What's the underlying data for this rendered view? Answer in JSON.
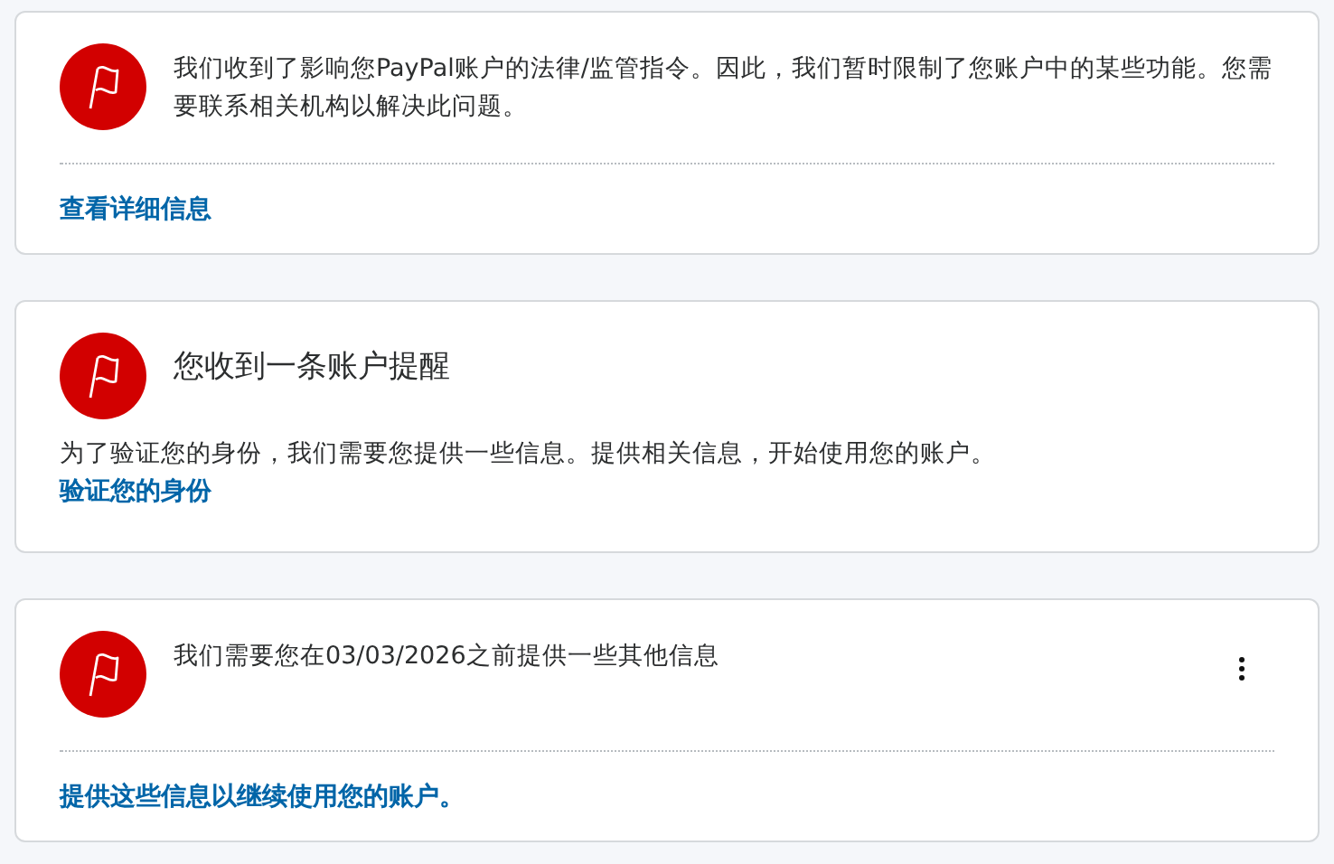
{
  "cards": [
    {
      "kind": "notice",
      "message": "我们收到了影响您PayPal账户的法律/监管指令。因此，我们暂时限制了您账户中的某些功能。您需要联系相关机构以解决此问题。",
      "link": "查看详细信息",
      "menu": false
    },
    {
      "kind": "alert",
      "title": "您收到一条账户提醒",
      "body": "为了验证您的身份，我们需要您提供一些信息。提供相关信息，开始使用您的账户。",
      "link": "验证您的身份"
    },
    {
      "kind": "notice",
      "message": "我们需要您在03/03/2026之前提供一些其他信息",
      "link": "提供这些信息以继续使用您的账户。",
      "menu": true
    }
  ]
}
